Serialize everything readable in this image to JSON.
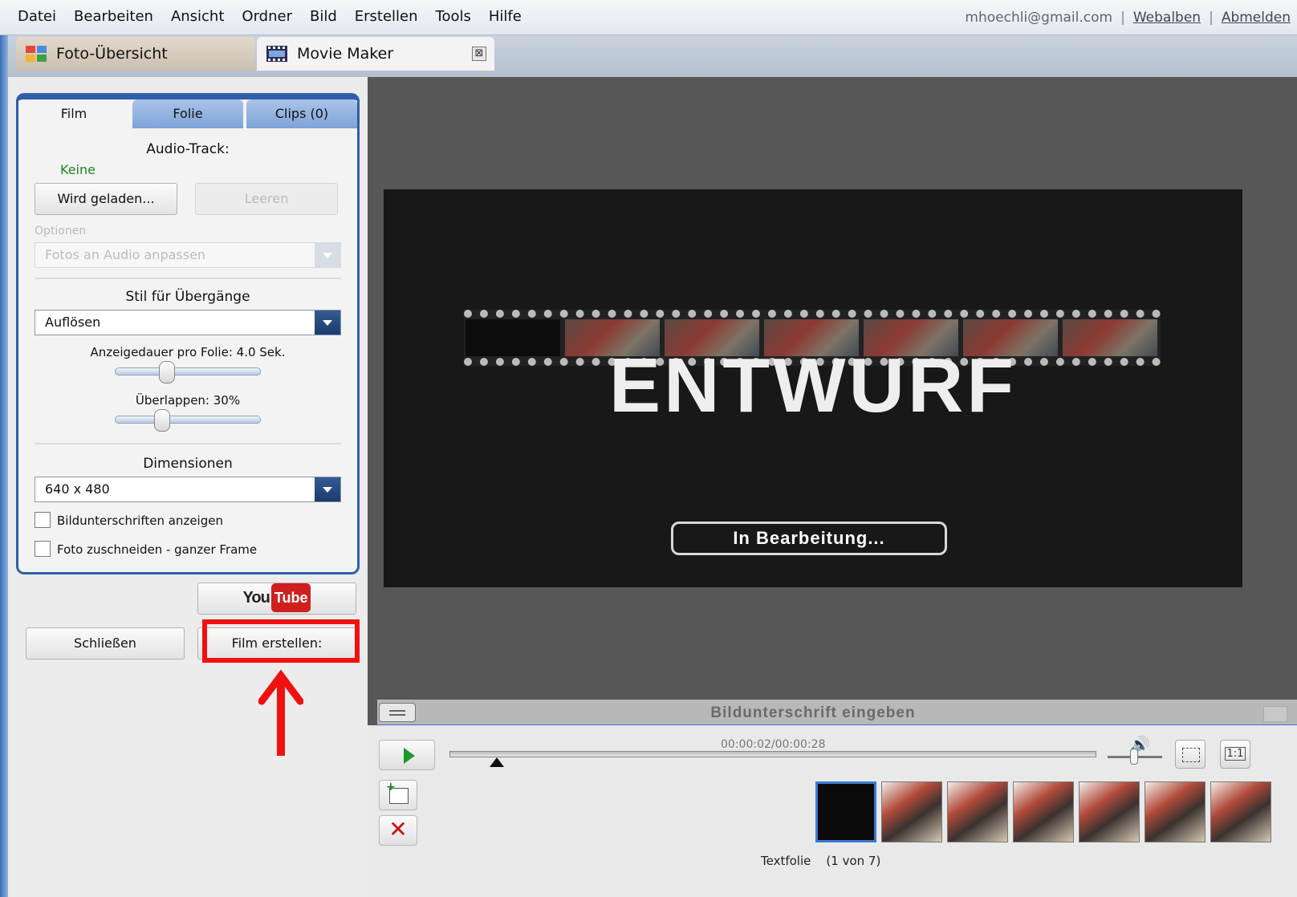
{
  "menu": {
    "items": [
      "Datei",
      "Bearbeiten",
      "Ansicht",
      "Ordner",
      "Bild",
      "Erstellen",
      "Tools",
      "Hilfe"
    ],
    "account_email": "mhoechli@gmail.com",
    "webalben_label": "Webalben",
    "abmelden_label": "Abmelden",
    "separator": "|"
  },
  "tabs": {
    "photo_overview": "Foto-Übersicht",
    "movie_maker": "Movie Maker",
    "close_glyph": "⊠"
  },
  "panel": {
    "subtabs": [
      "Film",
      "Folie",
      "Clips (0)"
    ],
    "audio_track_heading": "Audio-Track:",
    "audio_track_value": "Keine",
    "load_button": "Wird geladen...",
    "clear_button": "Leeren",
    "options_label": "Optionen",
    "options_dropdown_value": "Fotos an Audio anpassen",
    "transition_heading": "Stil für Übergänge",
    "transition_value": "Auflösen",
    "duration_label": "Anzeigedauer pro Folie: 4.0 Sek.",
    "duration_value_sec": 4.0,
    "overlap_label": "Überlappen: 30%",
    "overlap_percent": 30,
    "dimensions_heading": "Dimensionen",
    "dimensions_value": "640 x 480",
    "checkbox_captions": "Bildunterschriften anzeigen",
    "checkbox_crop": "Foto zuschneiden - ganzer Frame",
    "captions_checked": false,
    "crop_checked": false
  },
  "bottom_buttons": {
    "youtube_you": "You",
    "youtube_tube": "Tube",
    "close_button": "Schließen",
    "create_button": "Film erstellen:"
  },
  "preview": {
    "draft_text": "ENTWURF",
    "status_pill": "In Bearbeitung...",
    "caption_placeholder": "Bildunterschrift eingeben"
  },
  "timeline": {
    "timecode": "00:00:02/00:00:28",
    "one_to_one_label": "1:1",
    "slide_status": "Textfolie    (1 von 7)",
    "thumbnail_count": 7,
    "selected_index": 0
  },
  "colors": {
    "accent_blue": "#2f5fa8",
    "audio_none_green": "#1a8a1a",
    "highlight_red": "#f01010"
  }
}
